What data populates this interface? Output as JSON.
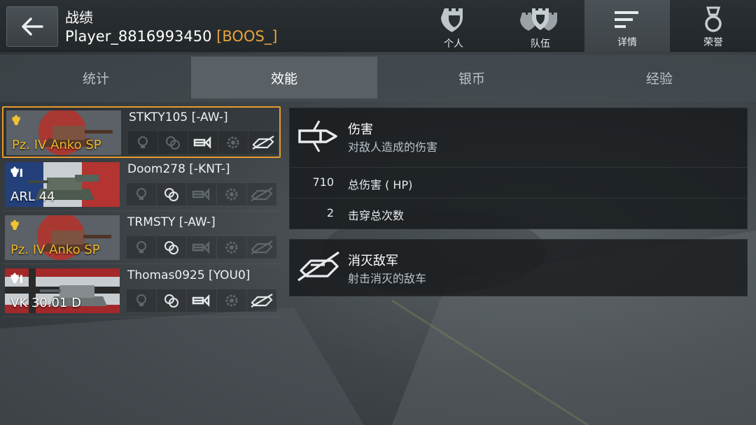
{
  "header": {
    "title": "战绩",
    "player_name": "Player_8816993450",
    "player_clan": "[BOOS_]",
    "nav": [
      {
        "label": "个人",
        "icon": "personal-emblem-icon"
      },
      {
        "label": "队伍",
        "icon": "team-emblem-icon"
      },
      {
        "label": "详情",
        "icon": "details-lines-icon",
        "active": true
      },
      {
        "label": "荣誉",
        "icon": "honor-medal-icon"
      }
    ]
  },
  "subtabs": [
    {
      "label": "统计"
    },
    {
      "label": "效能",
      "active": true
    },
    {
      "label": "银币"
    },
    {
      "label": "经验"
    }
  ],
  "players": [
    {
      "tier": "V",
      "tank": "Pz. IV Anko SP",
      "player": "STKTY105 [-AW-]",
      "flag": "japan",
      "premium": true,
      "selected": true,
      "medals_active": [
        false,
        false,
        true,
        false,
        true
      ]
    },
    {
      "tier": "VI",
      "tank": "ARL 44",
      "player": "Doom278 [-KNT-]",
      "flag": "france",
      "premium": false,
      "selected": false,
      "medals_active": [
        false,
        true,
        false,
        false,
        false
      ]
    },
    {
      "tier": "V",
      "tank": "Pz. IV Anko SP",
      "player": "TRMSTY [-AW-]",
      "flag": "japan",
      "premium": true,
      "selected": false,
      "medals_active": [
        false,
        true,
        false,
        false,
        false
      ]
    },
    {
      "tier": "VI",
      "tank": "VK 30.01 D",
      "player": "Thomas0925 [YOU0]",
      "flag": "germany",
      "premium": false,
      "selected": false,
      "medals_active": [
        false,
        true,
        true,
        false,
        true
      ]
    }
  ],
  "damage_panel": {
    "title": "伤害",
    "subtitle": "对敌人造成的伤害",
    "stats": [
      {
        "value": "710",
        "label": "总伤害 ( HP)"
      },
      {
        "value": "2",
        "label": "击穿总次数"
      }
    ]
  },
  "kills_panel": {
    "title": "消灭敌军",
    "subtitle": "射击消灭的敌车"
  },
  "colors": {
    "accent": "#e89a2e",
    "clan": "#e8a33c",
    "premium_tank": "#f0b72c"
  }
}
